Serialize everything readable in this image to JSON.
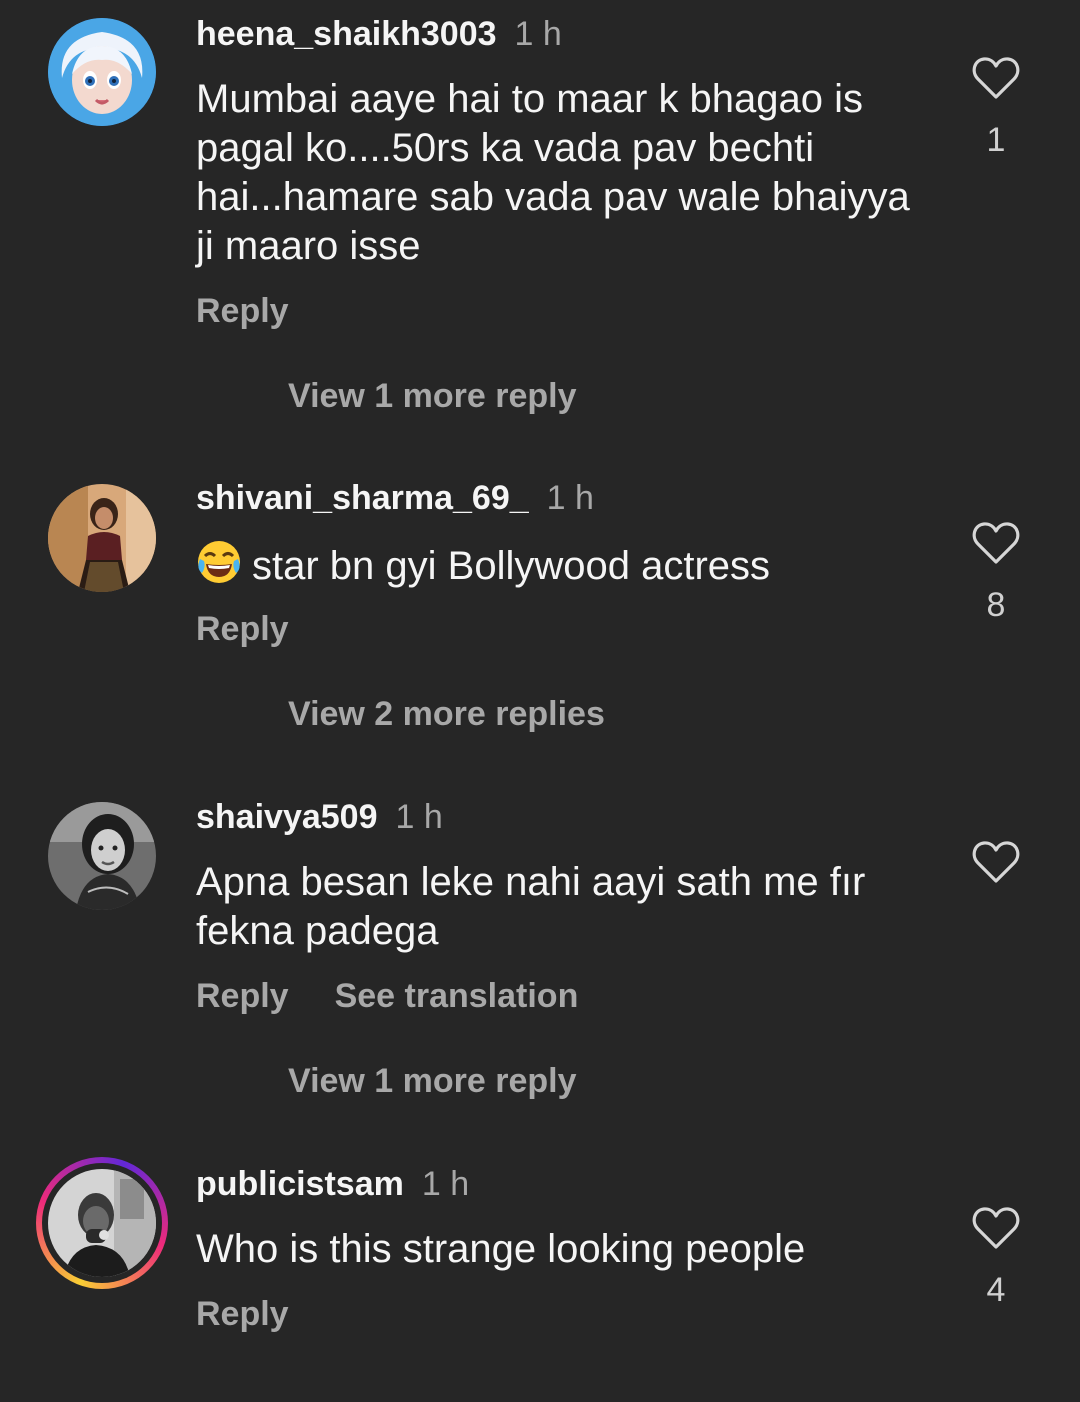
{
  "comments": [
    {
      "username": "heena_shaikh3003",
      "time": "1 h",
      "text": "Mumbai aaye hai to maar k bhagao is pagal ko....50rs ka vada pav bechti hai...hamare sab vada pav wale bhaiyya ji maaro isse",
      "reply_label": "Reply",
      "view_more": "View 1 more reply",
      "like_count": "1",
      "avatar_icon": "cartoon-princess-avatar"
    },
    {
      "username": "shivani_sharma_69_",
      "time": "1 h",
      "emoji": "😂",
      "text": "star bn gyi Bollywood actress",
      "reply_label": "Reply",
      "view_more": "View 2 more replies",
      "like_count": "8",
      "avatar_icon": "selfie-avatar"
    },
    {
      "username": "shaivya509",
      "time": "1 h",
      "text": "Apna besan leke nahi aayi sath me fır fekna padega",
      "reply_label": "Reply",
      "translation_label": "See translation",
      "view_more": "View 1 more reply",
      "like_count": "",
      "avatar_icon": "portrait-avatar"
    },
    {
      "username": "publicistsam",
      "time": "1 h",
      "text": "Who is this strange looking people",
      "reply_label": "Reply",
      "like_count": "4",
      "avatar_icon": "story-ring-avatar"
    }
  ],
  "colors": {
    "background": "#262626",
    "primary_text": "#f5f5f5",
    "secondary_text": "#a8a8a8",
    "story_ring": [
      "#f9ce34",
      "#ee2a7b",
      "#6228d7"
    ]
  }
}
